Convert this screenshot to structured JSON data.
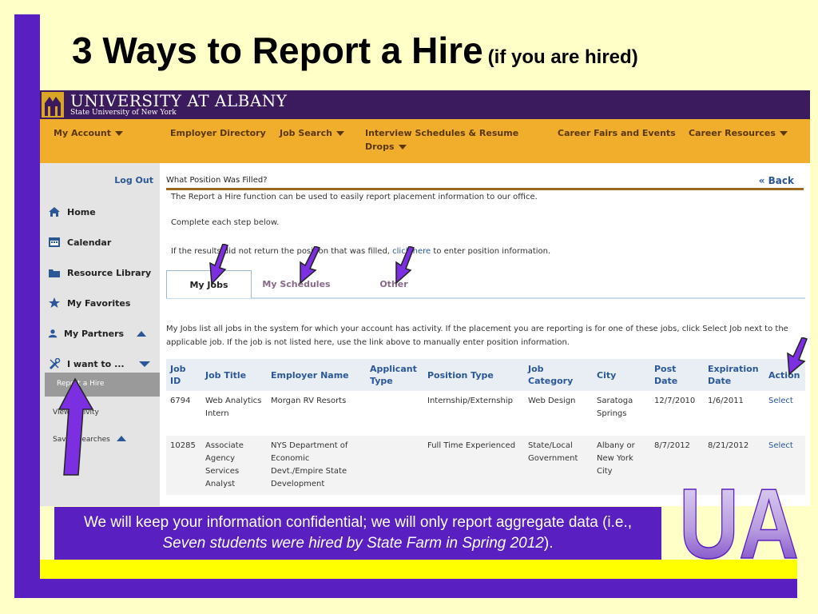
{
  "slide": {
    "title": "3 Ways to Report a Hire",
    "subtitle": "(if you are hired)",
    "note_part1": "We will keep your information confidential; we will only report aggregate data (i.e., ",
    "note_italic": "Seven students were hired by State Farm in Spring 2012",
    "note_part2": ").",
    "ua_logo_text": "UA"
  },
  "header": {
    "university_name": "UNIVERSITY AT ALBANY",
    "university_subtitle": "State University of New York"
  },
  "nav": {
    "items": [
      {
        "label": "My Account",
        "caret": true
      },
      {
        "label": "Employer Directory",
        "caret": false
      },
      {
        "label": "Job Search",
        "caret": true
      },
      {
        "label": "Interview Schedules & Resume",
        "label2": "Drops",
        "caret": true
      },
      {
        "label": "Career Fairs and Events",
        "caret": false
      },
      {
        "label": "Career Resources",
        "caret": true
      }
    ]
  },
  "sidebar": {
    "logout": "Log Out",
    "items": [
      {
        "label": "Home",
        "icon": "home-icon"
      },
      {
        "label": "Calendar",
        "icon": "calendar-icon"
      },
      {
        "label": "Resource Library",
        "icon": "folder-icon"
      },
      {
        "label": "My Favorites",
        "icon": "star-icon"
      },
      {
        "label": "My Partners",
        "icon": "person-icon"
      },
      {
        "label": "I want to ...",
        "icon": "tools-icon"
      }
    ],
    "selected": "Report a Hire",
    "sub_items": [
      "View Activity",
      "Saved Searches"
    ]
  },
  "main": {
    "title": "What Position Was Filled?",
    "back": "« Back",
    "intro": "The Report a Hire function can be used to easily report placement information to our office.",
    "step": "Complete each step below.",
    "if_text_before": "If the results did not return the position that was filled, ",
    "if_link": "click here",
    "if_text_after": " to enter position information.",
    "tabs": [
      "My Jobs",
      "My Schedules",
      "Other"
    ],
    "description": "My Jobs list all jobs in the system for which your account has activity.  If the placement you are reporting is for one of these jobs, click Select Job next to the applicable job.  If the job is not listed here, use the link above to manually enter position information."
  },
  "table": {
    "headers": [
      "Job ID",
      "Job Title",
      "Employer Name",
      "Applicant Type",
      "Position Type",
      "Job Category",
      "City",
      "Post Date",
      "Expiration Date",
      "Action"
    ],
    "rows": [
      [
        "6794",
        "Web Analytics Intern",
        "Morgan RV Resorts",
        "",
        "Internship/Externship",
        "Web Design",
        "Saratoga Springs",
        "12/7/2010",
        "1/6/2011",
        "Select"
      ],
      [
        "10285",
        "Associate Agency Services Analyst",
        "NYS Department of Economic Devt./Empire State Development",
        "",
        "Full Time Experienced",
        "State/Local Government",
        "Albany or New York City",
        "8/7/2012",
        "8/21/2012",
        "Select"
      ]
    ]
  },
  "colors": {
    "slide_bg": "#FFFFC8",
    "purple": "#5A1FC0",
    "yellow": "#FFFF00",
    "header_purple": "#3B1A5E",
    "nav_orange": "#F0AE2C",
    "link_blue": "#2B5797"
  }
}
